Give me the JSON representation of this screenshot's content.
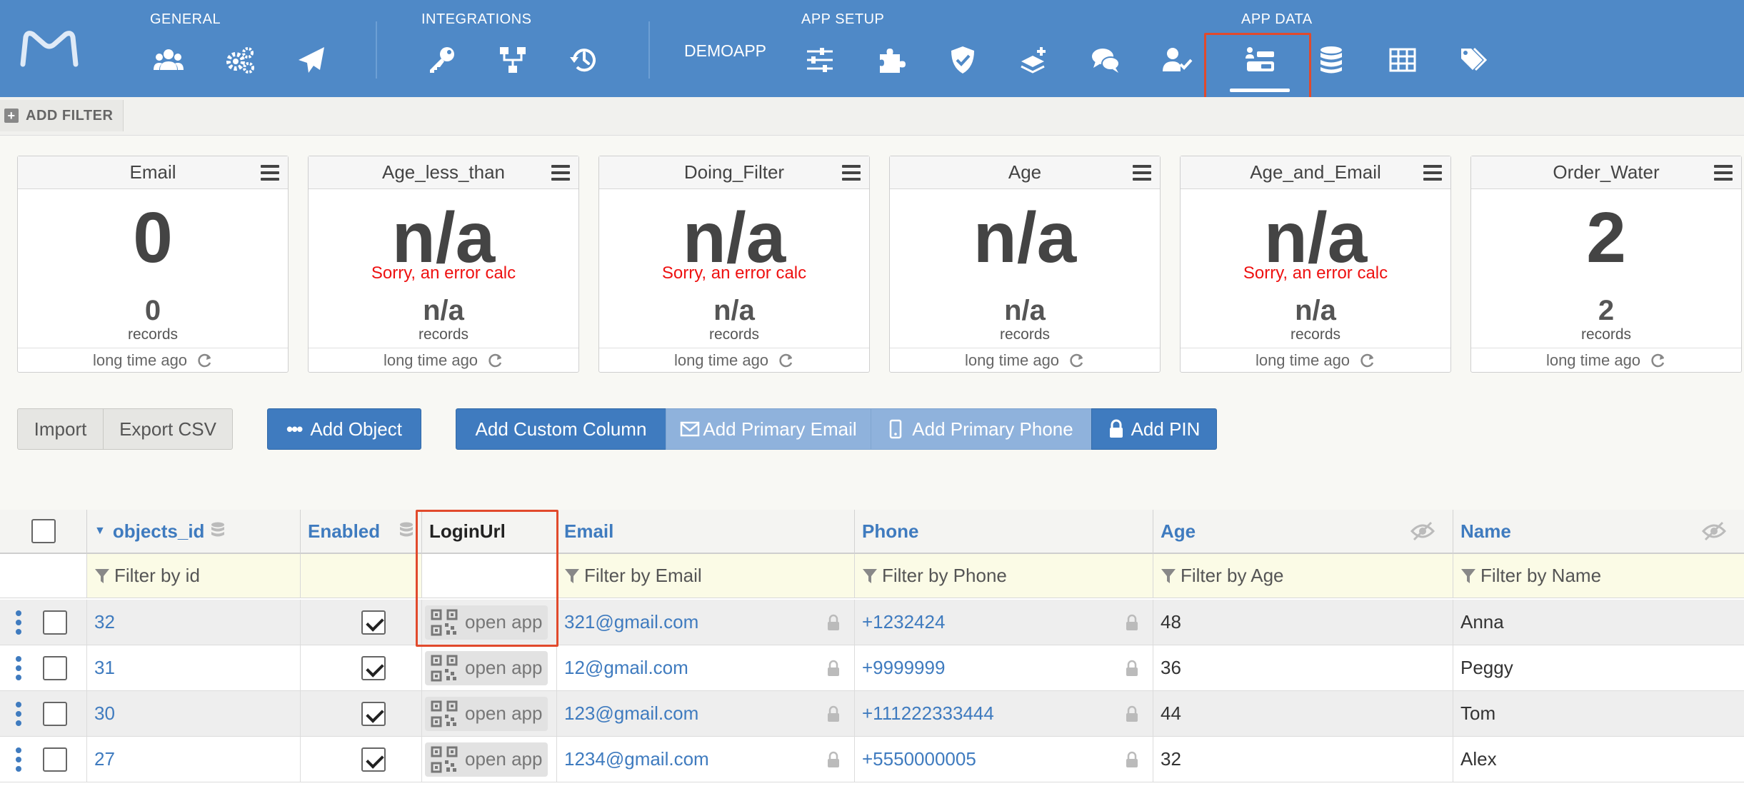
{
  "nav": {
    "sections": {
      "general": "GENERAL",
      "integrations": "INTEGRATIONS",
      "app_setup": "APP SETUP",
      "app_data": "APP DATA"
    },
    "app_name": "DEMOAPP",
    "active_icon": "objects-list-icon",
    "colors": {
      "bar": "#4f89c7",
      "highlight": "#e14a2c"
    }
  },
  "filterbar": {
    "add_filter": "ADD FILTER"
  },
  "widgets": [
    {
      "title": "Email",
      "value": "0",
      "error": "",
      "records": "0",
      "records_label": "records",
      "updated": "long time ago"
    },
    {
      "title": "Age_less_than",
      "value": "n/a",
      "error": "Sorry, an error calc",
      "records": "n/a",
      "records_label": "records",
      "updated": "long time ago"
    },
    {
      "title": "Doing_Filter",
      "value": "n/a",
      "error": "Sorry, an error calc",
      "records": "n/a",
      "records_label": "records",
      "updated": "long time ago"
    },
    {
      "title": "Age",
      "value": "n/a",
      "error": "",
      "records": "n/a",
      "records_label": "records",
      "updated": "long time ago"
    },
    {
      "title": "Age_and_Email",
      "value": "n/a",
      "error": "Sorry, an error calc",
      "records": "n/a",
      "records_label": "records",
      "updated": "long time ago"
    },
    {
      "title": "Order_Water",
      "value": "2",
      "error": "",
      "records": "2",
      "records_label": "records",
      "updated": "long time ago"
    }
  ],
  "toolbar": {
    "import": "Import",
    "export_csv": "Export CSV",
    "add_object": "Add Object",
    "add_custom_column": "Add Custom Column",
    "add_primary_email": "Add Primary Email",
    "add_primary_phone": "Add Primary Phone",
    "add_pin": "Add PIN"
  },
  "table": {
    "columns": {
      "objects_id": "objects_id",
      "enabled": "Enabled",
      "loginurl": "LoginUrl",
      "email": "Email",
      "phone": "Phone",
      "age": "Age",
      "name": "Name"
    },
    "filters": {
      "id": "Filter by id",
      "email": "Filter by Email",
      "phone": "Filter by Phone",
      "age": "Filter by Age",
      "name": "Filter by Name"
    },
    "open_app_label": "open app",
    "rows": [
      {
        "id": "32",
        "enabled": true,
        "email": "321@gmail.com",
        "phone": "+1232424",
        "age": "48",
        "name": "Anna"
      },
      {
        "id": "31",
        "enabled": true,
        "email": "12@gmail.com",
        "phone": "+9999999",
        "age": "36",
        "name": "Peggy"
      },
      {
        "id": "30",
        "enabled": true,
        "email": "123@gmail.com",
        "phone": "+111222333444",
        "age": "44",
        "name": "Tom"
      },
      {
        "id": "27",
        "enabled": true,
        "email": "1234@gmail.com",
        "phone": "+5550000005",
        "age": "32",
        "name": "Alex"
      }
    ]
  }
}
